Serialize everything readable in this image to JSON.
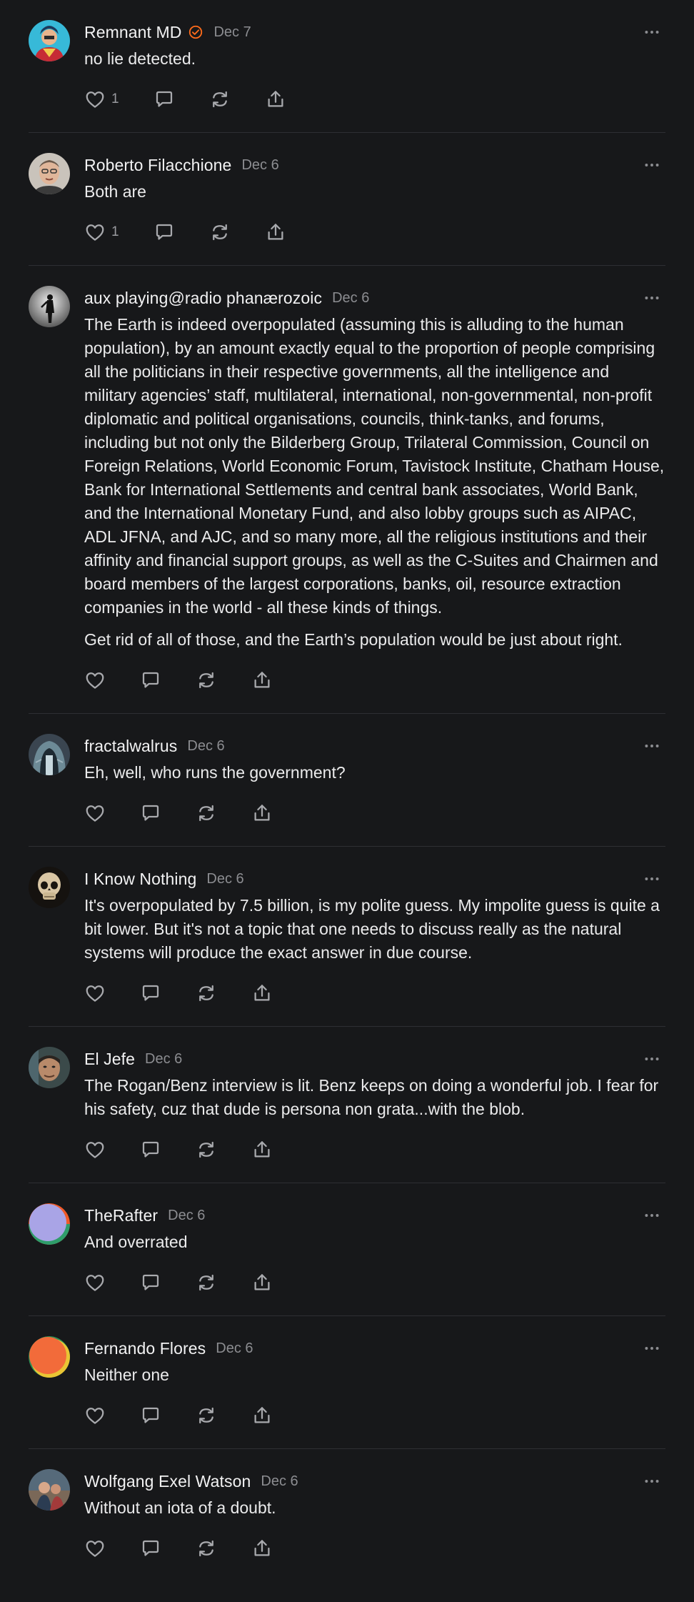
{
  "comments": [
    {
      "name": "Remnant MD",
      "verified": true,
      "date": "Dec 7",
      "paragraphs": [
        "no lie detected."
      ],
      "likes": "1",
      "avatar_icon": "superhero-avatar"
    },
    {
      "name": "Roberto Filacchione",
      "verified": false,
      "date": "Dec 6",
      "paragraphs": [
        "Both are"
      ],
      "likes": "1",
      "avatar_icon": "portrait-avatar"
    },
    {
      "name": "aux playing@radio phanærozoic",
      "verified": false,
      "date": "Dec 6",
      "paragraphs": [
        "The Earth is indeed overpopulated (assuming this is alluding to the human population), by an amount exactly equal to the proportion of people comprising all the politicians in their respective governments, all the intelligence and military agencies’ staff, multilateral, international, non-governmental, non-profit diplomatic and political organisations, councils, think-tanks, and forums, including but not only the Bilderberg Group, Trilateral Commission, Council on Foreign Relations, World Economic Forum, Tavistock Institute, Chatham House, Bank for International Settlements and central bank associates, World Bank, and the International Monetary Fund, and also lobby groups such as AIPAC, ADL JFNA, and AJC, and so many more, all the religious institutions and their affinity and financial support groups, as well as the C-Suites and Chairmen and board members of the largest corporations, banks, oil, resource extraction companies in the world - all these kinds of things.",
        "Get rid of all of those, and the Earth’s population would be just about right."
      ],
      "likes": "",
      "avatar_icon": "silhouette-avatar"
    },
    {
      "name": "fractalwalrus",
      "verified": false,
      "date": "Dec 6",
      "paragraphs": [
        "Eh, well, who runs the government?"
      ],
      "likes": "",
      "avatar_icon": "tunnel-avatar"
    },
    {
      "name": "I Know Nothing",
      "verified": false,
      "date": "Dec 6",
      "paragraphs": [
        "It's overpopulated by 7.5 billion, is my polite guess. My impolite guess is quite a bit lower. But it's not a topic that one needs to discuss really as the natural systems will produce the exact answer in due course."
      ],
      "likes": "",
      "avatar_icon": "skull-avatar"
    },
    {
      "name": "El Jefe",
      "verified": false,
      "date": "Dec 6",
      "paragraphs": [
        "The Rogan/Benz interview is lit. Benz keeps on doing a wonderful job. I fear for his safety, cuz that dude is persona non grata...with the blob."
      ],
      "likes": "",
      "avatar_icon": "face-avatar"
    },
    {
      "name": "TheRafter",
      "verified": false,
      "date": "Dec 6",
      "paragraphs": [
        "And overrated"
      ],
      "likes": "",
      "avatar_icon": "default-purple-avatar"
    },
    {
      "name": "Fernando Flores",
      "verified": false,
      "date": "Dec 6",
      "paragraphs": [
        "Neither one"
      ],
      "likes": "",
      "avatar_icon": "default-orange-avatar"
    },
    {
      "name": "Wolfgang Exel Watson",
      "verified": false,
      "date": "Dec 6",
      "paragraphs": [
        "Without an iota of a doubt."
      ],
      "likes": "",
      "avatar_icon": "photo-avatar"
    }
  ],
  "colors": {
    "background": "#17181a",
    "text": "#ebebec",
    "muted": "#8c8d91",
    "icon": "#a9aaae",
    "divider": "#2e2f33",
    "verified": "#ff6b1a"
  }
}
